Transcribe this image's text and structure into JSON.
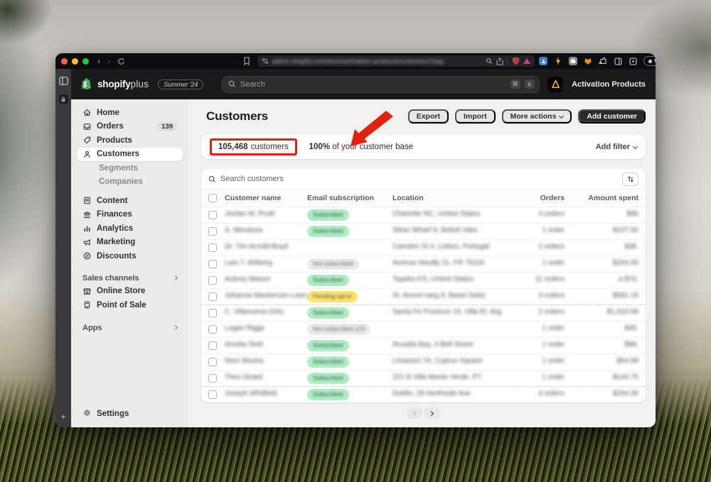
{
  "colors": {
    "annotation_red": "#e0220b",
    "badge_green": "#aeeec6",
    "badge_yellow": "#ffe66b",
    "badge_gray": "#ebebeb",
    "accent_dark": "#2b2b2b"
  },
  "browser": {
    "url_text": "admin.shopify.com/store/activation-products/customers?seg",
    "vpn_label": "VPN"
  },
  "topbar": {
    "logo_main": "shopify",
    "logo_suffix": "plus",
    "version_badge": "Summer '24",
    "search_placeholder": "Search",
    "shortcut_keys": [
      "⌘",
      "K"
    ],
    "account_name": "Activation Products"
  },
  "sidebar": {
    "items": [
      {
        "label": "Home",
        "icon": "home-icon"
      },
      {
        "label": "Orders",
        "icon": "orders-icon",
        "badge": "139"
      },
      {
        "label": "Products",
        "icon": "products-icon"
      },
      {
        "label": "Customers",
        "icon": "customers-icon",
        "active": true
      },
      {
        "label": "Segments",
        "sub": true
      },
      {
        "label": "Companies",
        "sub": true
      },
      {
        "gap": "s-gap8"
      },
      {
        "label": "Content",
        "icon": "content-icon"
      },
      {
        "label": "Finances",
        "icon": "finances-icon"
      },
      {
        "label": "Analytics",
        "icon": "analytics-icon"
      },
      {
        "label": "Marketing",
        "icon": "marketing-icon"
      },
      {
        "label": "Discounts",
        "icon": "discounts-icon"
      },
      {
        "gap": "s-gap14"
      },
      {
        "header": "Sales channels",
        "chevron": true
      },
      {
        "label": "Online Store",
        "icon": "online-store-icon"
      },
      {
        "label": "Point of Sale",
        "icon": "pos-icon"
      },
      {
        "gap": "s-gap16"
      },
      {
        "header": "Apps",
        "chevron": true
      }
    ],
    "settings_label": "Settings"
  },
  "page": {
    "title": "Customers",
    "actions": {
      "export": "Export",
      "import": "Import",
      "more_actions": "More actions",
      "add_customer": "Add customer"
    },
    "metric": {
      "count": "105,468",
      "unit": "customers",
      "percent": "100%",
      "percent_rest": " of your customer base",
      "add_filter": "Add filter"
    },
    "table": {
      "search_placeholder": "Search customers",
      "columns": {
        "name": "Customer name",
        "email": "Email subscription",
        "location": "Location",
        "orders": "Orders",
        "amount": "Amount spent"
      },
      "rows": [
        {
          "name": "Jordan M. Pruitt",
          "badge": "green",
          "badge_label": "Subscribed",
          "location": "Charlotte NC, United States",
          "orders": "4 orders",
          "amount": "$96"
        },
        {
          "name": "A. Mendoza",
          "badge": "green",
          "badge_label": "Subscribed",
          "location": "Silver Wharf 8, British Isles",
          "orders": "1 order",
          "amount": "$107.50"
        },
        {
          "name": "Dr. Tim Arnold-Boyd",
          "badge": "none",
          "badge_label": "",
          "location": "Camden St 4, Lisbon, Portugal",
          "orders": "2 orders",
          "amount": "$38."
        },
        {
          "name": "Lars T. Ahlberg",
          "badge": "gray",
          "badge_label": "Not subscribed",
          "location": "Avenue Neuilly 21, FR 75116",
          "orders": "1 order",
          "amount": "$204.00"
        },
        {
          "name": "Aubrey Mason",
          "badge": "green",
          "badge_label": "Subscribed",
          "location": "Topeka KS, United States",
          "orders": "11 orders",
          "amount": "a $76."
        },
        {
          "name": "Johanna Mackenzie-Lowry",
          "badge": "yellow",
          "badge_label": "Pending opt-in",
          "location": "St. Annen-weg 9, Basel Switz.",
          "orders": "3 orders",
          "amount": "$591.15"
        },
        {
          "name": "C. Villanueva-Ortiz",
          "badge": "green",
          "badge_label": "Subscribed",
          "location": "Santa Fe Province 15, Villa El. Arg.",
          "orders": "2 orders",
          "amount": "$1,010.68"
        },
        {
          "name": "Logan Riggs",
          "badge": "gray",
          "badge_label": "Not subscribed 123",
          "location": "",
          "orders": "1 order",
          "amount": "$45."
        },
        {
          "name": "Amelia Stott",
          "badge": "green",
          "badge_label": "Subscribed",
          "location": "Arcadia Bay, 4 Bell Street",
          "orders": "1 order",
          "amount": "$98."
        },
        {
          "name": "Noor Boulos",
          "badge": "green",
          "badge_label": "Subscribed",
          "location": "Limassol 7A, Cyprus Square",
          "orders": "1 order",
          "amount": "$54.99"
        },
        {
          "name": "Theo Girard",
          "badge": "green",
          "badge_label": "Subscribed",
          "location": "221 B Villa Monte Verde, PT",
          "orders": "1 order",
          "amount": "$143.75"
        },
        {
          "name": "Joseph Whitfield",
          "badge": "green",
          "badge_label": "Subscribed",
          "location": "Dublin, 29 Northside Ave",
          "orders": "4 orders",
          "amount": "$264.30"
        }
      ]
    }
  }
}
